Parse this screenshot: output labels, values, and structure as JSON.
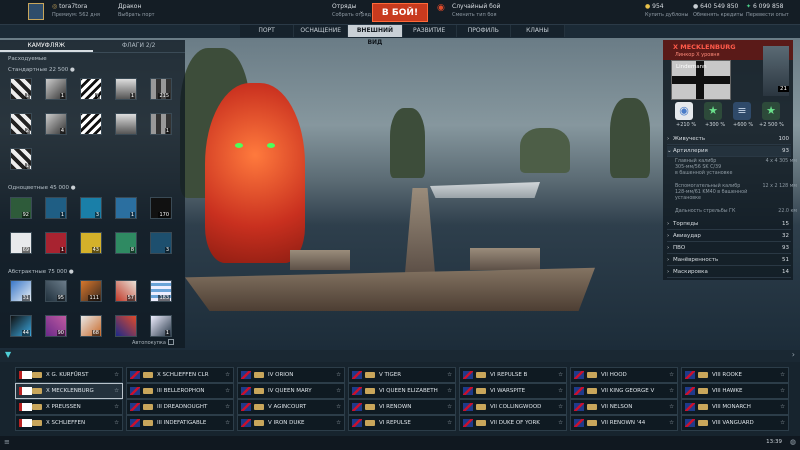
{
  "topbar": {
    "player": "tora7tora",
    "premium": "Премиум: 562 дня",
    "port": "Дракон",
    "port_sub": "Выбрать порт",
    "squads": "Отряды",
    "squads_sub": "Собрать отряд",
    "battle": "В БОЙ!",
    "mode": "Случайный бой",
    "mode_sub": "Сменить тип боя",
    "doubloons": "954",
    "doubloons_sub": "Купить дублоны",
    "credits": "640 549 850",
    "credits_sub": "Обменять кредиты",
    "free_xp": "6 099 858",
    "free_xp_sub": "Перевести опыт"
  },
  "nav": {
    "tabs": [
      "ПОРТ",
      "ОСНАЩЕНИЕ",
      "ВНЕШНИЙ ВИД",
      "РАЗВИТИЕ",
      "ПРОФИЛЬ",
      "КЛАНЫ"
    ],
    "active": "ВНЕШНИЙ ВИД"
  },
  "left": {
    "tab_camo": "КАМУФЛЯЖ",
    "tab_flags": "ФЛАГИ 2/2",
    "consumables": "Расходуемые",
    "standard": "Стандартные",
    "standard_price": "22 500",
    "standard_counts": [
      "1",
      "1",
      "7",
      "1",
      "215",
      "2",
      "4",
      "",
      "",
      "1",
      "1"
    ],
    "single": "Одноцветные",
    "single_price": "45 000",
    "single_counts": [
      "92",
      "1",
      "3",
      "1",
      "170",
      "69",
      "1",
      "43",
      "8",
      "3"
    ],
    "abstract": "Абстрактные",
    "abstract_price": "75 000",
    "abstract_counts": [
      "31",
      "95",
      "111",
      "57",
      "183",
      "44",
      "90",
      "68",
      "",
      "1"
    ],
    "autobuy": "Автопокупка"
  },
  "right": {
    "ship_name": "X MECKLENBURG",
    "ship_class": "Линкор X уровня",
    "commander": "Lindemann",
    "level": "21",
    "flag_bonuses": [
      "+210 %",
      "+300 %",
      "+600 %",
      "+2 500 %"
    ],
    "rows": {
      "survivability": {
        "label": "Живучесть",
        "value": "100"
      },
      "artillery": {
        "label": "Артиллерия",
        "value": "93"
      },
      "torpedoes": {
        "label": "Торпеды",
        "value": "15"
      },
      "aviation": {
        "label": "Авиаудар",
        "value": "32"
      },
      "aa": {
        "label": "ПВО",
        "value": "93"
      },
      "maneuver": {
        "label": "Манёвренность",
        "value": "51"
      },
      "concealment": {
        "label": "Маскировка",
        "value": "14"
      }
    },
    "art_details": {
      "main_label": "Главный калибр",
      "main_value": "4 x 4  305 мм",
      "main_desc": "305-мм/56 SK C/39",
      "main_desc2": "в башенной установке",
      "sec_label": "Вспомогательный калибр",
      "sec_value": "12 x 2  128 мм",
      "sec_desc": "128-мм/61 KM40 в башенной",
      "sec_desc2": "установке",
      "range_label": "Дальность стрельбы ГК",
      "range_value": "22.0 км"
    }
  },
  "carousel": {
    "rows": [
      [
        "X G. KURFÜRST",
        "X SCHLIEFFEN CLR",
        "IV ORION",
        "V TIGER",
        "VI REPULSE B",
        "VII HOOD",
        "VIII ROOKE"
      ],
      [
        "X MECKLENBURG",
        "III BELLEROPHON",
        "IV QUEEN MARY",
        "VI QUEEN ELIZABETH",
        "VI WARSPITE",
        "VII KING GEORGE V",
        "VIII HAWKE"
      ],
      [
        "X PREUSSEN",
        "III DREADNOUGHT",
        "V AGINCOURT",
        "VI RENOWN",
        "VII COLLINGWOOD",
        "VII NELSON",
        "VIII MONARCH"
      ],
      [
        "X SCHLIEFFEN",
        "III INDEFATIGABLE",
        "V IRON DUKE",
        "VI REPULSE",
        "VII DUKE OF YORK",
        "VII RENOWN '44",
        "VIII VANGUARD"
      ]
    ],
    "selected": "X MECKLENBURG",
    "star": "☆"
  },
  "bottom": {
    "clock": "13:39"
  },
  "colors": {
    "battle": "#c83a1e",
    "accent": "#ff5a4a",
    "premium": "#ff9d4a"
  }
}
